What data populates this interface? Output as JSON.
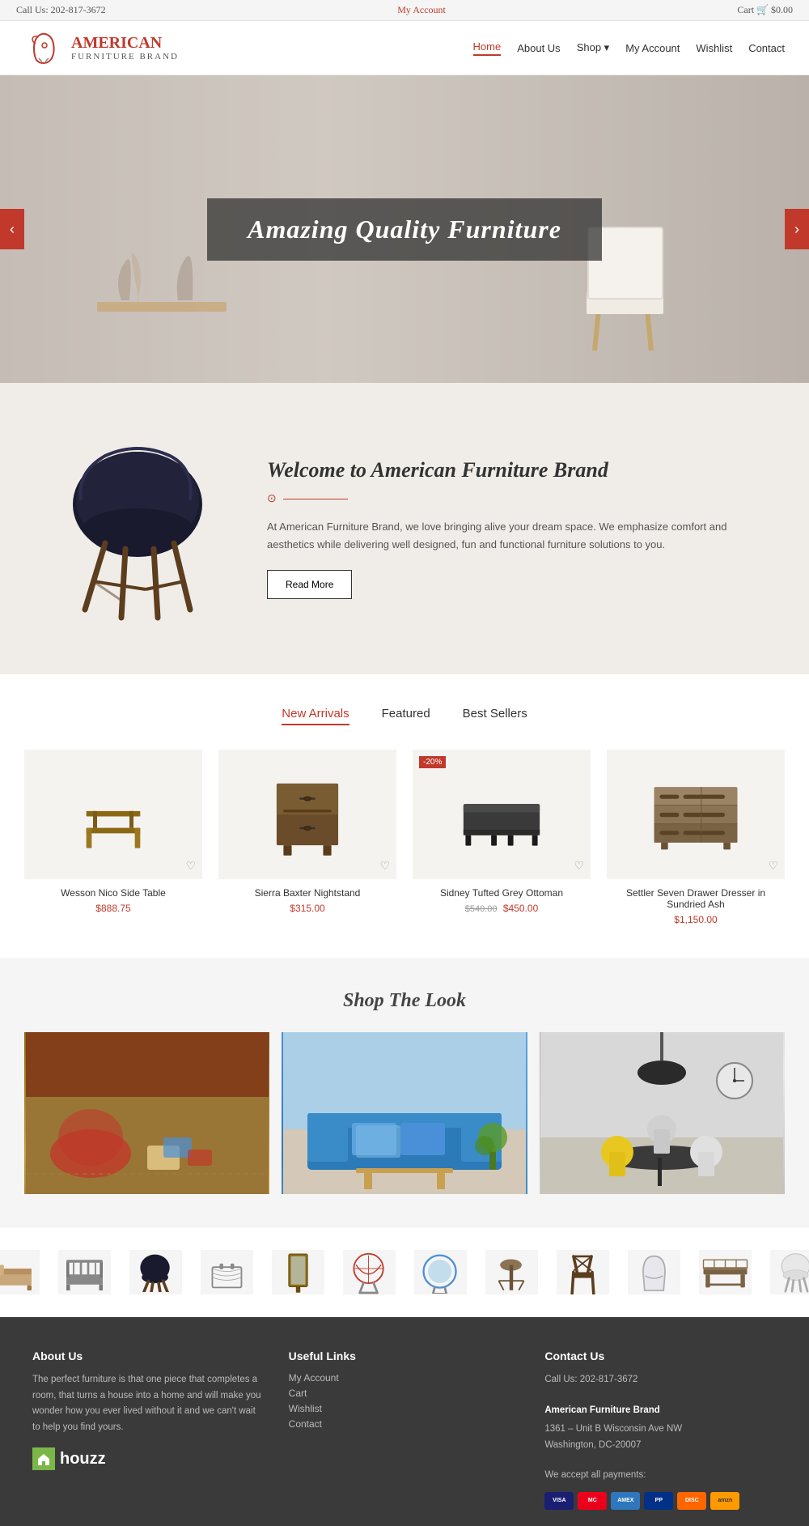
{
  "topbar": {
    "call_text": "Call Us: 202-817-3672",
    "account_link": "My Account",
    "cart_text": "Cart",
    "cart_price": "$0.00"
  },
  "header": {
    "brand_name": "AMERICAN",
    "brand_sub": "FURNITURE BRAND",
    "nav_items": [
      {
        "label": "Home",
        "active": true
      },
      {
        "label": "About Us",
        "active": false
      },
      {
        "label": "Shop",
        "active": false,
        "has_dropdown": true
      },
      {
        "label": "My Account",
        "active": false
      },
      {
        "label": "Wishlist",
        "active": false
      },
      {
        "label": "Contact",
        "active": false
      }
    ]
  },
  "hero": {
    "slide_text": "Amazing Quality Furniture",
    "prev_label": "‹",
    "next_label": "›"
  },
  "welcome": {
    "heading": "Welcome to American Furniture Brand",
    "body": "At American Furniture Brand, we love bringing alive your dream space. We emphasize comfort and aesthetics while delivering well designed, fun and functional furniture solutions to you.",
    "read_more": "Read More"
  },
  "products": {
    "tabs": [
      {
        "label": "New Arrivals",
        "active": true
      },
      {
        "label": "Featured",
        "active": false
      },
      {
        "label": "Best Sellers",
        "active": false
      }
    ],
    "items": [
      {
        "name": "Wesson Nico Side Table",
        "price": "$888.75",
        "old_price": null,
        "sale": false
      },
      {
        "name": "Sierra Baxter Nightstand",
        "price": "$315.00",
        "old_price": null,
        "sale": false
      },
      {
        "name": "Sidney Tufted Grey Ottoman",
        "price": "$450.00",
        "old_price": "$540.00",
        "sale": true,
        "sale_badge": "-20%"
      },
      {
        "name": "Settler Seven Drawer Dresser in Sundried Ash",
        "price": "$1,150.00",
        "old_price": null,
        "sale": false
      }
    ]
  },
  "shop_look": {
    "heading": "Shop The Look",
    "items": [
      {
        "alt": "Bohemian living room"
      },
      {
        "alt": "Blue sofa living room"
      },
      {
        "alt": "Modern dining room"
      }
    ]
  },
  "footer": {
    "about": {
      "heading": "About Us",
      "text": "The perfect furniture is that one piece that completes a room, that turns a house into a home and will make you wonder how you ever lived without it and we can't wait to help you find yours.",
      "houzz_label": "houzz"
    },
    "useful_links": {
      "heading": "Useful Links",
      "links": [
        "My Account",
        "Cart",
        "Wishlist",
        "Contact"
      ]
    },
    "contact": {
      "heading": "Contact Us",
      "phone": "Call Us: 202-817-3672",
      "brand": "American Furniture Brand",
      "address": "1361 – Unit B Wisconsin Ave NW",
      "city": "Washington, DC-20007",
      "payments_label": "We accept all payments:"
    }
  }
}
